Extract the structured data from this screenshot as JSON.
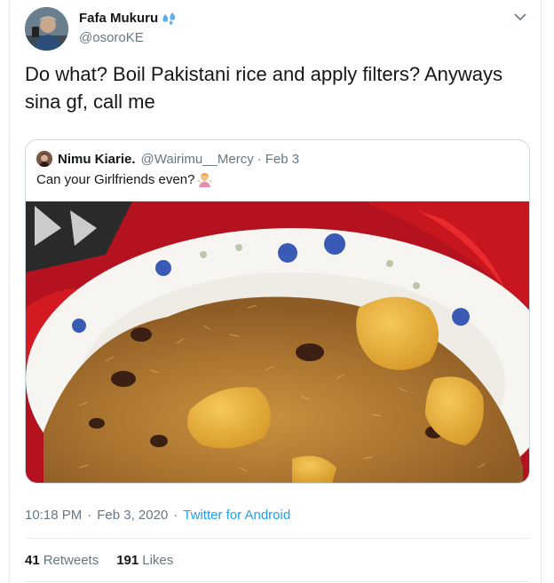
{
  "author": {
    "display_name": "Fafa Mukuru",
    "handle": "@osoroKE"
  },
  "tweet": {
    "text": "Do what? Boil Pakistani rice and apply filters? Anyways sina gf, call me"
  },
  "quoted_tweet": {
    "display_name": "Nimu Kiarie.",
    "handle": "@Wairimu__Mercy",
    "separator": "·",
    "date": "Feb 3",
    "text": "Can your Girlfriends even?",
    "emoji": "woman-shrugging-icon"
  },
  "meta": {
    "time": "10:18 PM",
    "date": "Feb 3, 2020",
    "source": "Twitter for Android",
    "separator": "·"
  },
  "stats": {
    "retweets_count": "41",
    "retweets_label": "Retweets",
    "likes_count": "191",
    "likes_label": "Likes"
  },
  "colors": {
    "link": "#1da1f2",
    "secondary_text": "#657786",
    "border": "#ccd6dd"
  }
}
